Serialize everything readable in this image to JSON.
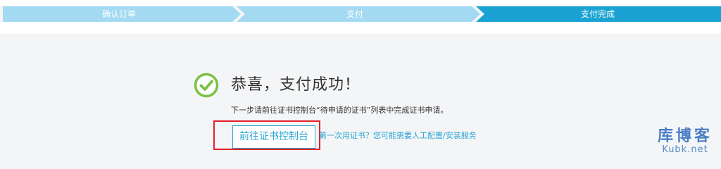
{
  "steps": [
    {
      "label": "确认订单",
      "state": "done"
    },
    {
      "label": "支付",
      "state": "done"
    },
    {
      "label": "支付完成",
      "state": "active"
    }
  ],
  "colors": {
    "step_done": "#a3daf2",
    "step_active": "#1aa3d2",
    "accent": "#2aa6d4",
    "success": "#7ac143",
    "highlight": "#e0222a"
  },
  "result": {
    "icon": "check-circle-icon",
    "title": "恭喜，支付成功！",
    "tip": "下一步请前往证书控制台“待申请的证书”列表中完成证书申请。"
  },
  "actions": {
    "console_button": "前往证书控制台",
    "help_link": "第一次用证书？您可能需要人工配置/安装服务"
  },
  "watermark": {
    "cn": "库博客",
    "en": "Kubk.net"
  }
}
